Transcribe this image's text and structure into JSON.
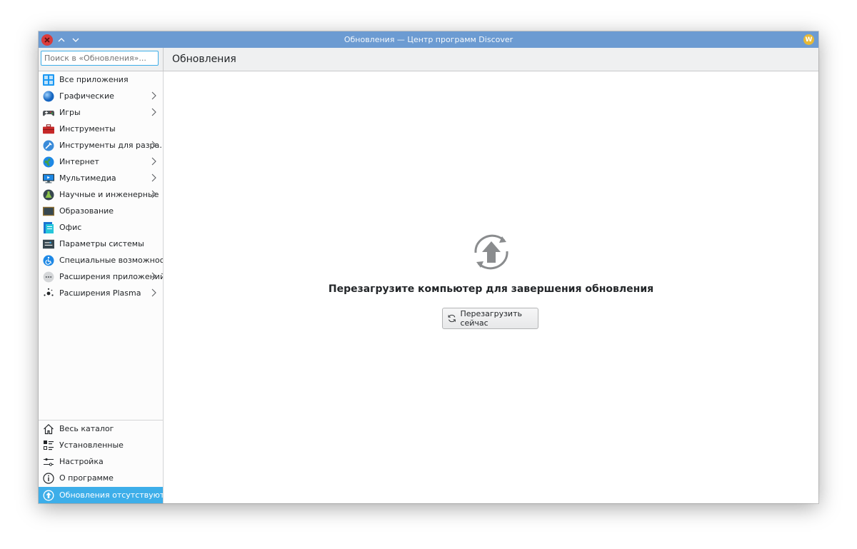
{
  "window": {
    "title": "Обновления — Центр программ Discover",
    "app_icon_letter": "W"
  },
  "toolbar": {
    "search_placeholder": "Поиск в «Обновления»...",
    "page_title": "Обновления"
  },
  "sidebar": {
    "categories": [
      {
        "label": "Все приложения",
        "icon": "grid-apps-icon",
        "has_submenu": false
      },
      {
        "label": "Графические",
        "icon": "graphics-sphere-icon",
        "has_submenu": true
      },
      {
        "label": "Игры",
        "icon": "gamepad-icon",
        "has_submenu": true
      },
      {
        "label": "Инструменты",
        "icon": "toolbox-icon",
        "has_submenu": false
      },
      {
        "label": "Инструменты для разра…",
        "icon": "developer-tools-icon",
        "has_submenu": true
      },
      {
        "label": "Интернет",
        "icon": "globe-icon",
        "has_submenu": true
      },
      {
        "label": "Мультимедиа",
        "icon": "multimedia-monitor-icon",
        "has_submenu": true
      },
      {
        "label": "Научные и инженерные",
        "icon": "science-flask-icon",
        "has_submenu": true
      },
      {
        "label": "Образование",
        "icon": "chalkboard-icon",
        "has_submenu": false
      },
      {
        "label": "Офис",
        "icon": "office-document-icon",
        "has_submenu": false
      },
      {
        "label": "Параметры системы",
        "icon": "system-settings-icon",
        "has_submenu": false
      },
      {
        "label": "Специальные возможности",
        "icon": "accessibility-icon",
        "has_submenu": false
      },
      {
        "label": "Расширения приложений",
        "icon": "app-addons-icon",
        "has_submenu": true
      },
      {
        "label": "Расширения Plasma",
        "icon": "plasma-addons-icon",
        "has_submenu": true
      }
    ],
    "bottom": [
      {
        "label": "Весь каталог",
        "icon": "home-icon"
      },
      {
        "label": "Установленные",
        "icon": "installed-list-icon"
      },
      {
        "label": "Настройка",
        "icon": "settings-sliders-icon"
      },
      {
        "label": "О программе",
        "icon": "info-icon"
      },
      {
        "label": "Обновления отсутствуют",
        "icon": "update-arrow-icon",
        "active": true
      }
    ]
  },
  "main": {
    "message": "Перезагрузите компьютер для завершения обновления",
    "restart_button_label": "Перезагрузить сейчас"
  },
  "colors": {
    "titlebar": "#6c9bd2",
    "accent": "#3daee9",
    "close_button": "#da3b3b"
  }
}
